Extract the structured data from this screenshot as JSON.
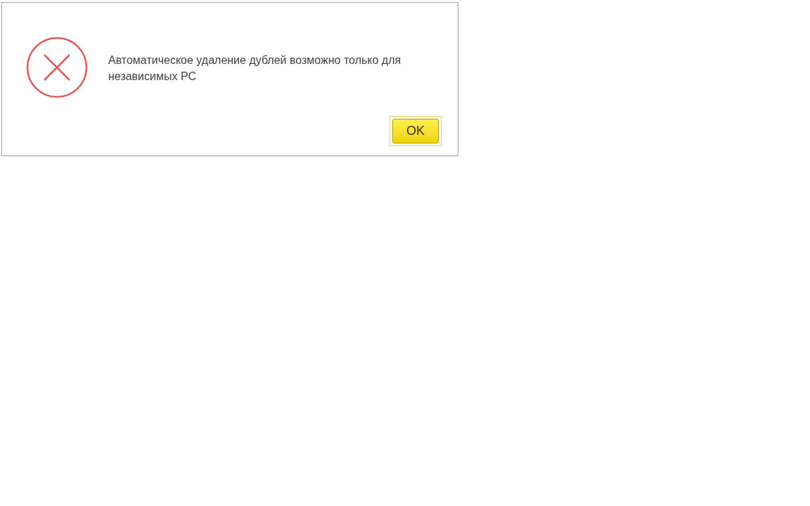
{
  "dialog": {
    "kind": "error",
    "message": "Автоматическое удаление дублей возможно только для независимых РС",
    "buttons": [
      {
        "label": "OK",
        "focused": true
      }
    ]
  }
}
